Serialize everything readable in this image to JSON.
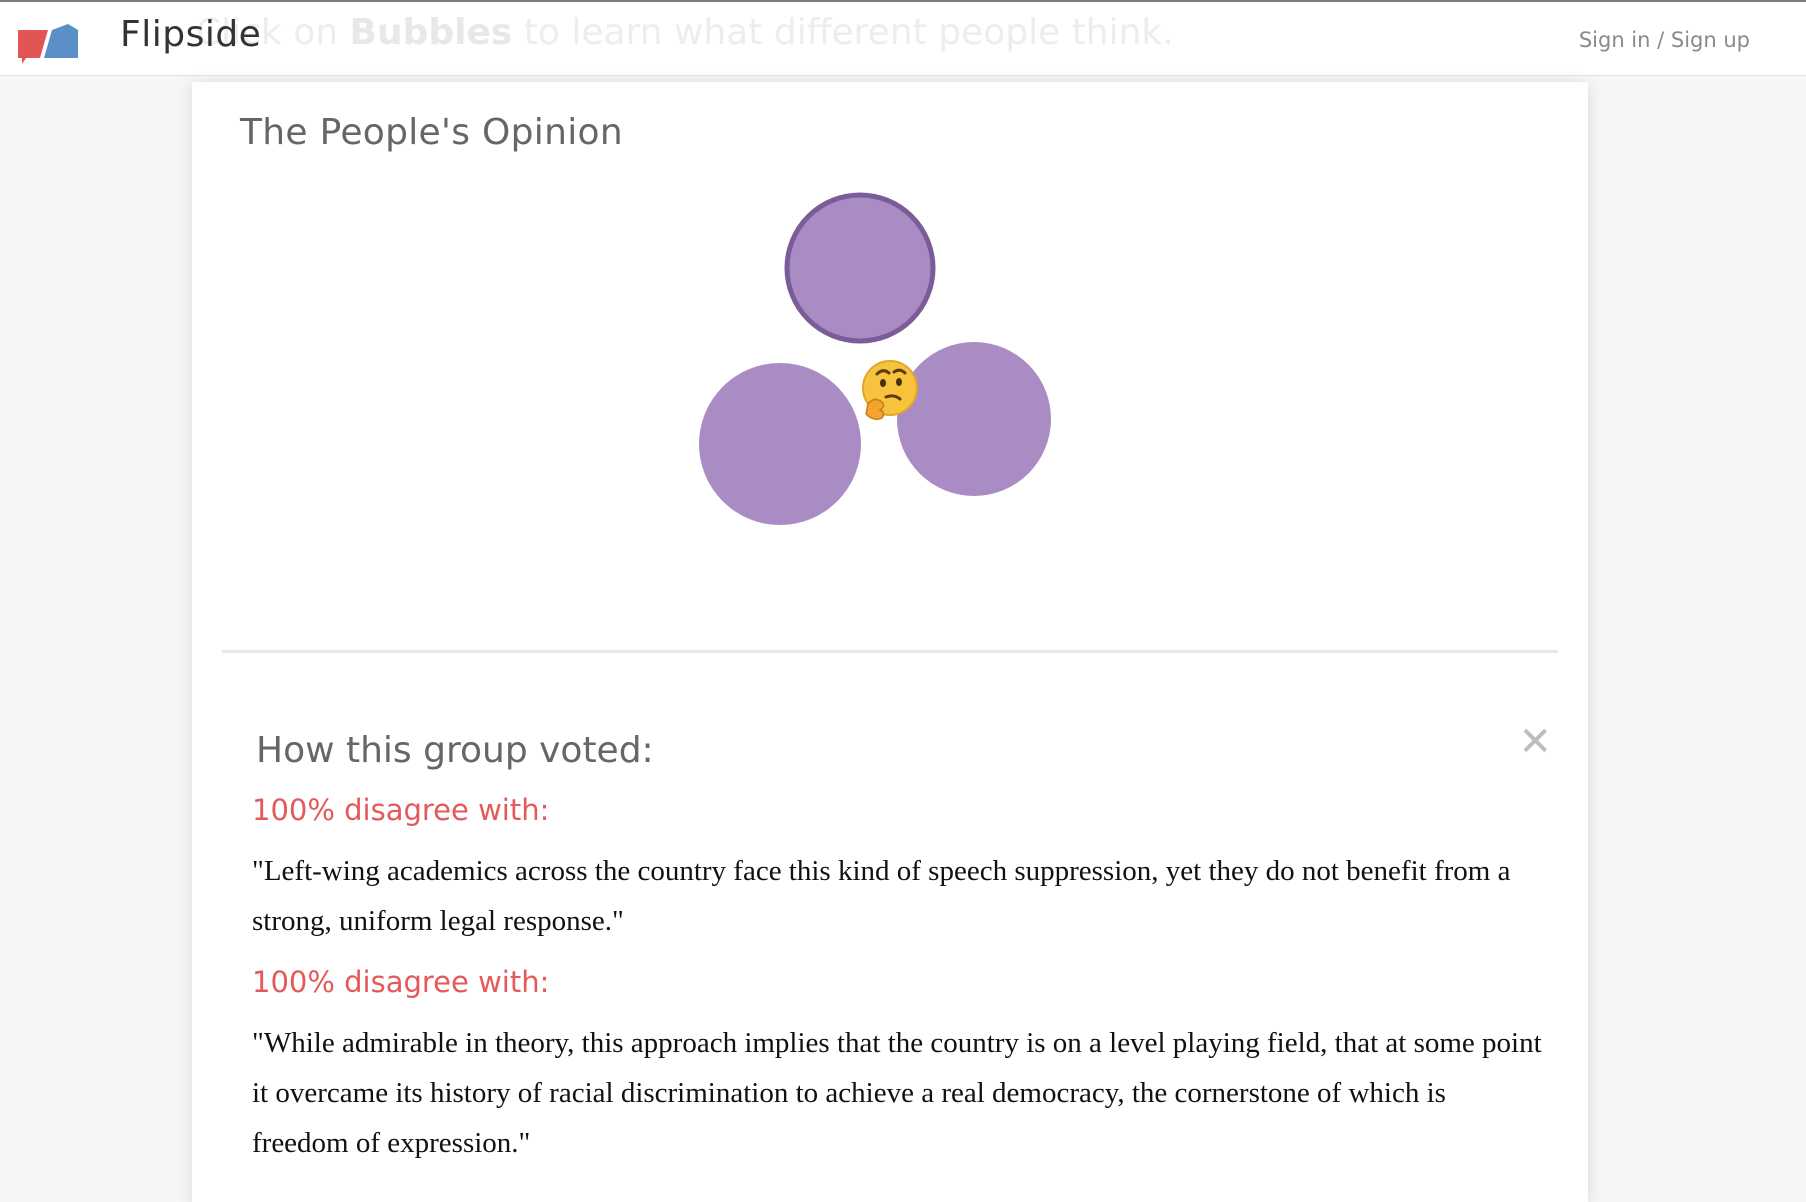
{
  "header": {
    "brand": "Flipside",
    "ghost_banner_prefix": "Click on ",
    "ghost_banner_bold": "Bubbles",
    "ghost_banner_suffix": " to learn what different people think.",
    "signin_label": "Sign in / Sign up",
    "logo_colors": {
      "red": "#e25555",
      "blue": "#5b8fc7"
    }
  },
  "opinion": {
    "title": "The People's Opinion",
    "bubble_color": "#a98cc4",
    "bubble_selected_stroke": "#7a5c99",
    "emoji": "thinking-face"
  },
  "group": {
    "title": "How this group voted:",
    "close_icon": "close-icon",
    "votes": [
      {
        "label": "100% disagree with:",
        "quote": "\"Left-wing academics across the country face this kind of speech suppression, yet they do not benefit from a strong, uniform legal response.\""
      },
      {
        "label": "100% disagree with:",
        "quote": "\"While admirable in theory, this approach implies that the country is on a level playing field, that at some point it overcame its history of racial discrimination to achieve a real democracy, the cornerstone of which is freedom of expression.\""
      }
    ]
  }
}
